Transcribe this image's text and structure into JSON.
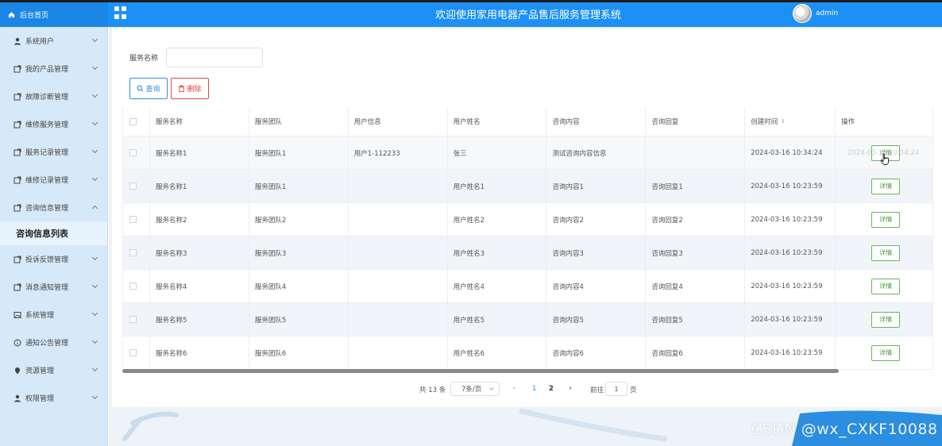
{
  "header": {
    "brand_label": "后台首页",
    "title": "欢迎使用家用电器产品售后服务管理系统",
    "username": "admin",
    "accent_color": "#1d90f5"
  },
  "sidebar": {
    "items": [
      {
        "label": "系统用户",
        "icon": "user-icon"
      },
      {
        "label": "我的产品管理",
        "icon": "doc-icon"
      },
      {
        "label": "故障诊断管理",
        "icon": "doc-icon"
      },
      {
        "label": "维修服务管理",
        "icon": "doc-icon"
      },
      {
        "label": "服务记录管理",
        "icon": "doc-icon"
      },
      {
        "label": "维修记录管理",
        "icon": "doc-icon"
      },
      {
        "label": "咨询信息管理",
        "icon": "doc-icon",
        "expanded": true
      },
      {
        "label": "投诉反馈管理",
        "icon": "doc-icon"
      },
      {
        "label": "消息通知管理",
        "icon": "doc-icon"
      },
      {
        "label": "系统管理",
        "icon": "image-icon"
      },
      {
        "label": "通知公告管理",
        "icon": "info-icon"
      },
      {
        "label": "资源管理",
        "icon": "pin-icon"
      },
      {
        "label": "权限管理",
        "icon": "user-icon"
      }
    ],
    "submenu_label": "咨询信息列表"
  },
  "search": {
    "label": "服务名称",
    "value": "",
    "placeholder": "",
    "query_label": "查询",
    "delete_label": "删除"
  },
  "table": {
    "headers": [
      "服务名称",
      "服务团队",
      "用户信息",
      "用户姓名",
      "咨询内容",
      "咨询回复",
      "创建时间",
      "操作"
    ],
    "rows": [
      [
        "服务名称1",
        "服务团队1",
        "用户1-112233",
        "张三",
        "测试咨询内容信息",
        "",
        "2024-03-16 10:34:24"
      ],
      [
        "服务名称1",
        "服务团队1",
        "",
        "用户姓名1",
        "咨询内容1",
        "咨询回复1",
        "2024-03-16 10:23:59"
      ],
      [
        "服务名称2",
        "服务团队2",
        "",
        "用户姓名2",
        "咨询内容2",
        "咨询回复2",
        "2024-03-16 10:23:59"
      ],
      [
        "服务名称3",
        "服务团队3",
        "",
        "用户姓名3",
        "咨询内容3",
        "咨询回复3",
        "2024-03-16 10:23:59"
      ],
      [
        "服务名称4",
        "服务团队4",
        "",
        "用户姓名4",
        "咨询内容4",
        "咨询回复4",
        "2024-03-16 10:23:59"
      ],
      [
        "服务名称5",
        "服务团队5",
        "",
        "用户姓名5",
        "咨询内容5",
        "咨询回复5",
        "2024-03-16 10:23:59"
      ],
      [
        "服务名称6",
        "服务团队6",
        "",
        "用户姓名6",
        "咨询内容6",
        "咨询回复6",
        "2024-03-16 10:23:59"
      ]
    ],
    "detail_label": "详情",
    "ghost_text": "2024-03-16 10:34:24"
  },
  "pagination": {
    "total": "共 13 条",
    "page_size": "7条/页",
    "pages": [
      "1",
      "2"
    ],
    "current_page": 1,
    "goto_label": "前往",
    "goto_value": "1",
    "goto_unit": "页",
    "prev_glyph": "‹",
    "next_glyph": "›"
  },
  "watermark": "CSDN @wx_CXKF10088"
}
